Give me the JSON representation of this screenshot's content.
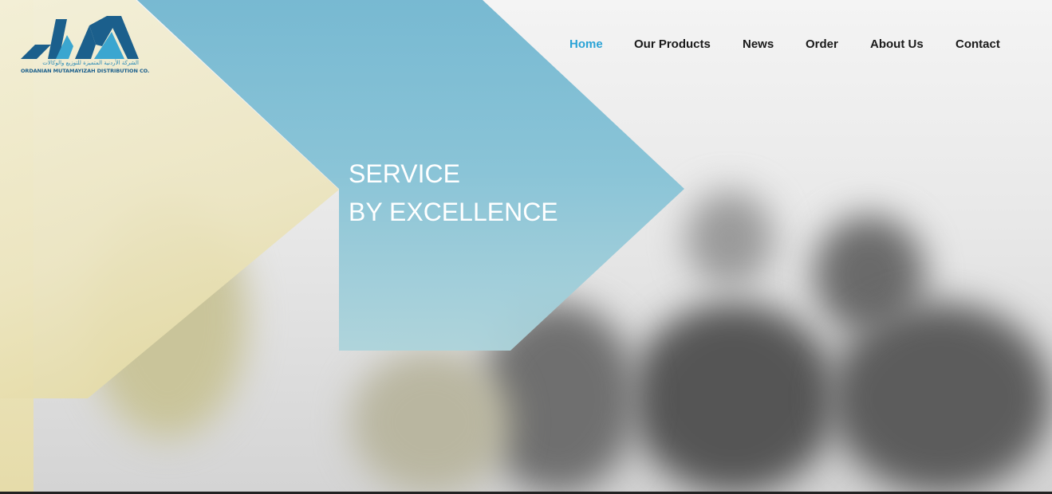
{
  "logo": {
    "arabic_text": "الشركة الأردنية المتميزة للتوزيع والوكالات",
    "latin_text": "ORDANIAN MUTAMAYIZAH DISTRIBUTION CO."
  },
  "nav": {
    "items": [
      {
        "label": "Home",
        "active": true
      },
      {
        "label": "Our Products"
      },
      {
        "label": "News"
      },
      {
        "label": "Order"
      },
      {
        "label": "About Us"
      },
      {
        "label": "Contact"
      }
    ]
  },
  "hero": {
    "line1": "SERVICE",
    "line2": "BY EXCELLENCE"
  },
  "colors": {
    "accent": "#2aa3d6",
    "banner_blue": "#78bbd2",
    "banner_yellow": "#ece5c0",
    "logo_dark": "#1b5f8c"
  }
}
